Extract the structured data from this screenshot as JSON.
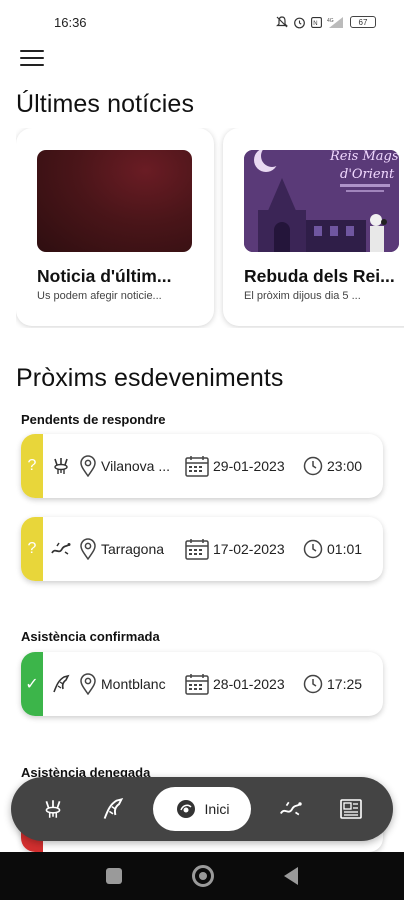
{
  "status_bar": {
    "time": "16:36",
    "battery": "67",
    "icons": [
      "mute-icon",
      "alarm-icon",
      "nfc-icon",
      "signal-icon"
    ]
  },
  "header": {
    "menu_icon": "hamburger-menu-icon"
  },
  "news": {
    "title": "Últimes notícies",
    "items": [
      {
        "title": "Noticia d'últim...",
        "summary": "Us podem afegir noticie..."
      },
      {
        "title": "Rebuda dels Rei...",
        "summary": "El pròxim dijous dia 5 ...",
        "image_text": "Reis Mags d'Orient"
      }
    ]
  },
  "events": {
    "title": "Pròxims esdeveniments",
    "groups": [
      {
        "label": "Pendents de respondre",
        "status_color": "#e8d63a",
        "status_symbol": "?",
        "items": [
          {
            "type_icon": "dancers-icon",
            "location": "Vilanova ...",
            "date": "29-01-2023",
            "time": "23:00"
          },
          {
            "type_icon": "dragon-icon",
            "location": "Tarragona",
            "date": "17-02-2023",
            "time": "01:01"
          }
        ]
      },
      {
        "label": "Asistència confirmada",
        "status_color": "#3cb54a",
        "status_symbol": "✓",
        "items": [
          {
            "type_icon": "eagle-icon",
            "location": "Montblanc",
            "date": "28-01-2023",
            "time": "17:25"
          }
        ]
      },
      {
        "label": "Asistència denegada",
        "status_color": "#d32f2f",
        "items": []
      }
    ]
  },
  "bottom_nav": {
    "items": [
      "dancers-icon",
      "eagle-icon",
      "home",
      "dragon-icon",
      "newspaper-icon"
    ],
    "home_label": "Inici",
    "background": "#444444"
  }
}
